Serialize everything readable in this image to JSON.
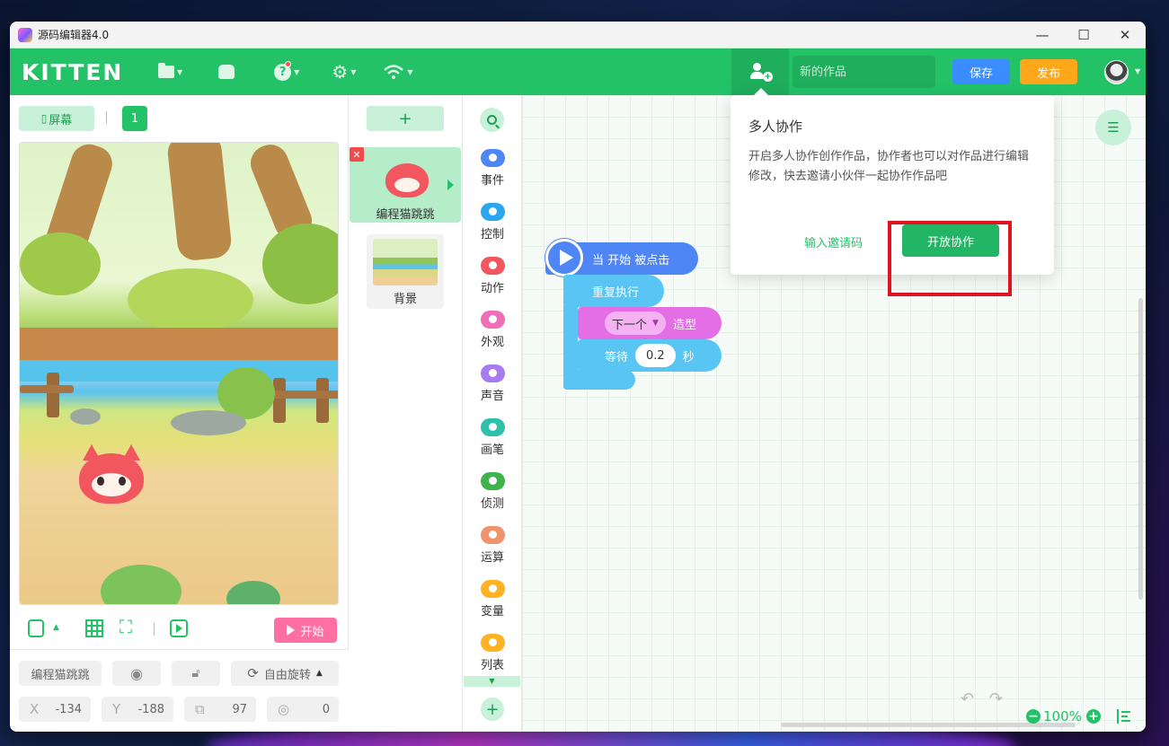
{
  "window": {
    "title": "源码编辑器4.0",
    "controls": {
      "minimize": "—",
      "maximize": "☐",
      "close": "✕"
    }
  },
  "topbar": {
    "logo": "KITTEN",
    "menu_icons": [
      "folder-icon",
      "backpack-icon",
      "help-icon",
      "settings-icon",
      "wifi-icon"
    ],
    "project_title_placeholder": "新的作品",
    "save_label": "保存",
    "publish_label": "发布",
    "colors": {
      "bar": "#23c267",
      "save": "#3b8cff",
      "publish": "#ffa71a"
    }
  },
  "stage_panel": {
    "screen_label": "屏幕",
    "page_number": "1",
    "start_label": "开始",
    "sprite_props": {
      "name": "编程猫跳跳",
      "rotation_label": "自由旋转",
      "x_label": "X",
      "x_value": "-134",
      "y_label": "Y",
      "y_value": "-188",
      "size_value": "97",
      "direction_value": "0"
    }
  },
  "sprite_panel": {
    "add_label": "+",
    "sprites": [
      {
        "name": "编程猫跳跳"
      }
    ],
    "background": {
      "name": "背景"
    }
  },
  "categories": [
    {
      "label": "事件",
      "color": "#4f86f5"
    },
    {
      "label": "控制",
      "color": "#2aa7f0"
    },
    {
      "label": "动作",
      "color": "#f2565e"
    },
    {
      "label": "外观",
      "color": "#f06fb6"
    },
    {
      "label": "声音",
      "color": "#a77cf0"
    },
    {
      "label": "画笔",
      "color": "#2cc1a8"
    },
    {
      "label": "侦测",
      "color": "#3fb24a"
    },
    {
      "label": "运算",
      "color": "#f0936a"
    },
    {
      "label": "变量",
      "color": "#ffb324"
    },
    {
      "label": "列表",
      "color": "#ffb324"
    }
  ],
  "workspace": {
    "blocks": {
      "hat": "当 开始 被点击",
      "repeat": "重复执行",
      "costume_dropdown": "下一个",
      "costume_suffix": "造型",
      "wait_prefix": "等待",
      "wait_value": "0.2",
      "wait_suffix": "秒"
    },
    "zoom": "100%"
  },
  "collab_popup": {
    "title": "多人协作",
    "description": "开启多人协作创作作品，协作者也可以对作品进行编辑修改，快去邀请小伙伴一起协作作品吧",
    "invite_code_label": "输入邀请码",
    "open_button_label": "开放协作"
  }
}
